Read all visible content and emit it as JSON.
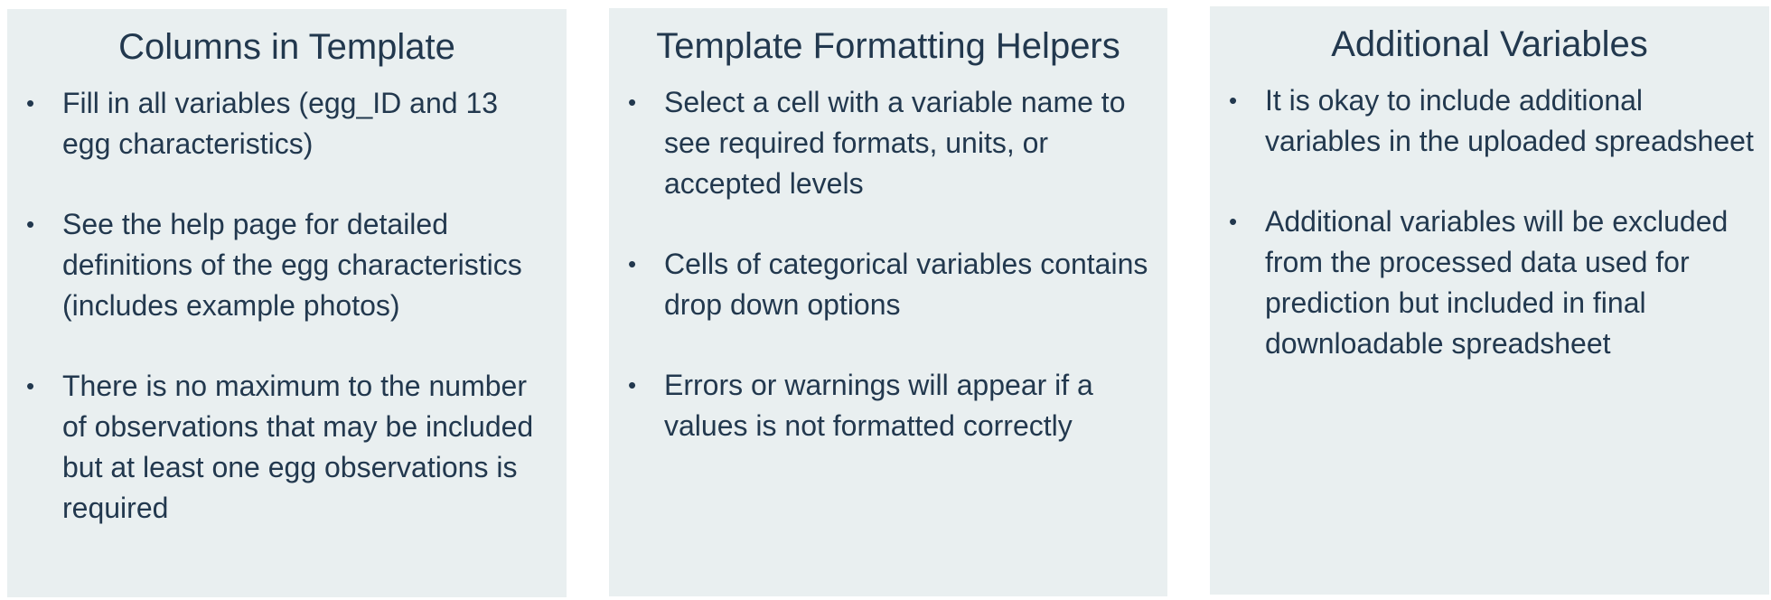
{
  "panels": [
    {
      "title": "Columns in Template",
      "bullets": [
        "Fill in all variables (egg_ID and 13 egg characteristics)",
        "See the help page for detailed definitions of the egg characteristics (includes example photos)",
        "There is no maximum to the number of observations that may be included but at least one egg observations is required"
      ]
    },
    {
      "title": "Template Formatting Helpers",
      "bullets": [
        "Select a cell with a variable name to see required formats, units, or accepted levels",
        "Cells of categorical variables contains drop down options",
        "Errors or warnings will appear if a values is not formatted correctly"
      ]
    },
    {
      "title": "Additional Variables",
      "bullets": [
        "It is okay to include additional variables in the uploaded spreadsheet",
        "Additional variables will be excluded from the processed data used for prediction but included in final downloadable spreadsheet"
      ]
    }
  ],
  "bullet_symbol": "•",
  "colors": {
    "panel_background": "#e9eff0",
    "text": "#22384e"
  }
}
